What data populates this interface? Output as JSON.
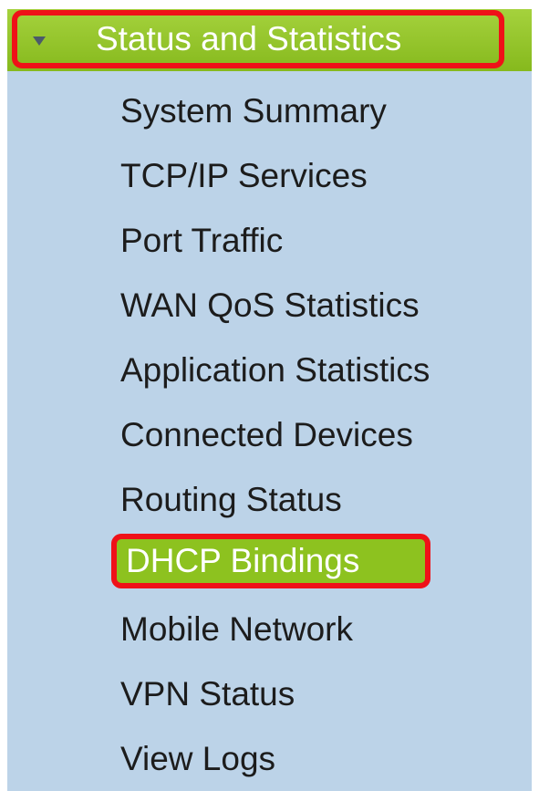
{
  "section": {
    "title": "Status and Statistics",
    "expanded": true,
    "icon": "caret-down-icon"
  },
  "menu": {
    "items": [
      {
        "label": "System Summary",
        "selected": false
      },
      {
        "label": "TCP/IP Services",
        "selected": false
      },
      {
        "label": "Port Traffic",
        "selected": false
      },
      {
        "label": "WAN QoS Statistics",
        "selected": false
      },
      {
        "label": "Application Statistics",
        "selected": false
      },
      {
        "label": "Connected Devices",
        "selected": false
      },
      {
        "label": "Routing Status",
        "selected": false
      },
      {
        "label": "DHCP Bindings",
        "selected": true
      },
      {
        "label": "Mobile Network",
        "selected": false
      },
      {
        "label": "VPN Status",
        "selected": false
      },
      {
        "label": "View Logs",
        "selected": false
      }
    ]
  },
  "colors": {
    "panel_background": "#bcd3e8",
    "header_green": "#8dc21f",
    "highlight_red": "#ef1118",
    "item_text": "#1c1c1c"
  }
}
